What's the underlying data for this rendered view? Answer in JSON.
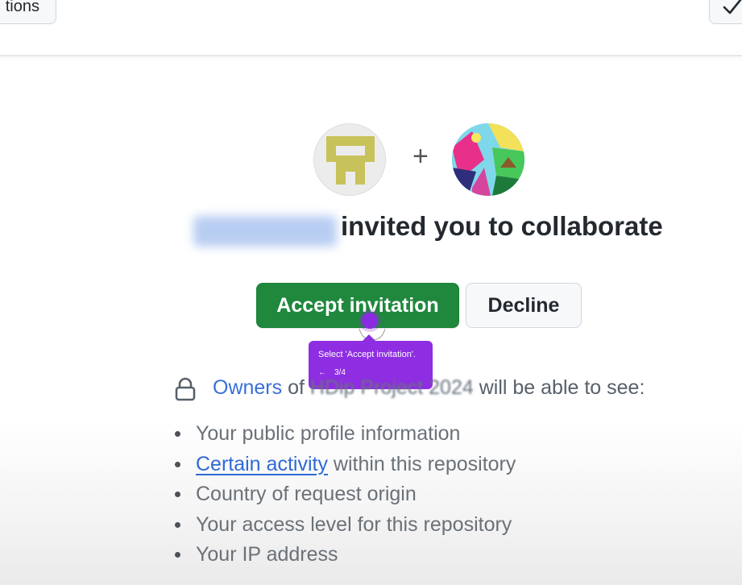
{
  "topbar": {
    "notifications_label": "tions",
    "check_icon": "check-icon"
  },
  "invite": {
    "plus": "+",
    "title": "invited you to collaborate",
    "accept_label": "Accept invitation",
    "decline_label": "Decline"
  },
  "tooltip": {
    "text": "Select 'Accept invitation'.",
    "back_arrow": "←",
    "step": "3/4"
  },
  "owners": {
    "link": "Owners",
    "of": " of ",
    "repo": "HDip Project 2024",
    "suffix": " will be able to see:"
  },
  "permissions": {
    "item1": "Your public profile information",
    "item2_link": "Certain activity",
    "item2_rest": " within this repository",
    "item3": "Country of request origin",
    "item4": "Your access level for this repository",
    "item5": "Your IP address"
  },
  "colors": {
    "accept_green": "#1f883d",
    "tooltip_purple": "#8e2de2",
    "link_blue": "#2f6ad6"
  }
}
